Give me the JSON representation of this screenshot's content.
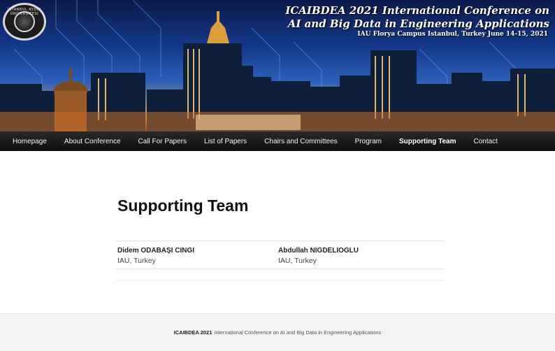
{
  "banner": {
    "logo_text": "İSTANBUL AYDIN ÜNİVERSİTESİ",
    "title_line1": "ICAIBDEA 2021 International Conference on",
    "title_line2": "AI and Big Data in Engineering Applications",
    "subtitle": "IAU Florya Campus Istanbul, Turkey June 14-15, 2021"
  },
  "nav": {
    "items": [
      {
        "label": "Homepage"
      },
      {
        "label": "About Conference"
      },
      {
        "label": "Call For Papers"
      },
      {
        "label": "List of Papers"
      },
      {
        "label": "Chairs and Committees"
      },
      {
        "label": "Program"
      },
      {
        "label": "Supporting Team",
        "active": true
      },
      {
        "label": "Contact"
      }
    ]
  },
  "main": {
    "title": "Supporting Team",
    "members": [
      {
        "name": "Didem ODABAŞI CINGI",
        "org": "IAU, Turkey"
      },
      {
        "name": "Abdullah NIGDELIOGLU",
        "org": "IAU, Turkey"
      }
    ]
  },
  "footer": {
    "brand": "ICAIBDEA 2021",
    "text": "International Conference on AI and Big Data in Engineering Applications"
  },
  "colors": {
    "nav_bg": "#111111",
    "footer_bg": "#f3f3f3",
    "title_text": "#111111"
  }
}
